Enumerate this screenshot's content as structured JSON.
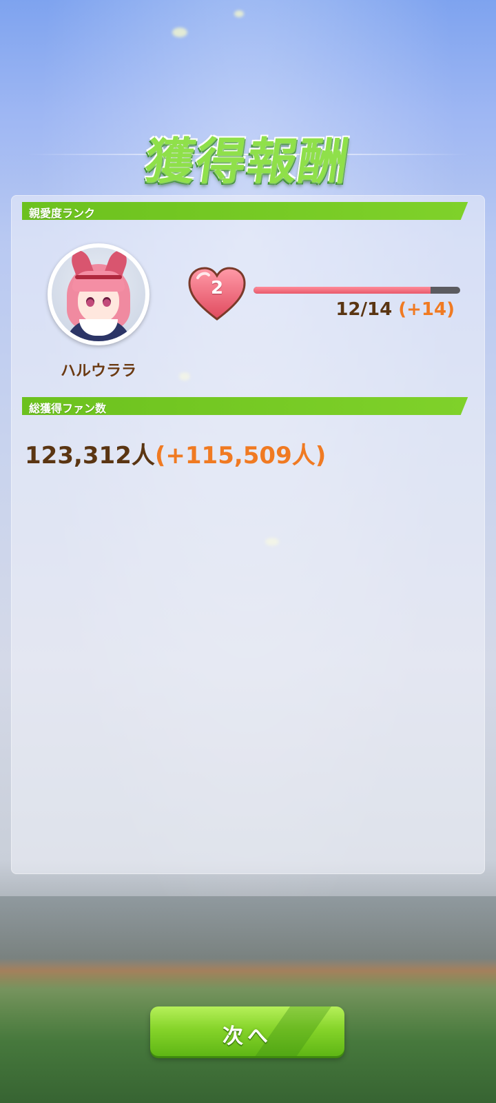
{
  "screen": {
    "title": "獲得報酬"
  },
  "affinity": {
    "section_label": "親愛度ランク",
    "character_name": "ハルウララ",
    "rank": "2",
    "progress_current": 12,
    "progress_max": 14,
    "progress_text": "12/14",
    "progress_gain": "(+14)"
  },
  "fans": {
    "section_label": "総獲得ファン数",
    "total": "123,312人",
    "gain": "(+115,509人)"
  },
  "next_button": {
    "label": "次へ"
  },
  "colors": {
    "accent_green": "#7fd12a",
    "text_brown": "#5a3512",
    "gain_orange": "#f07a22",
    "heart_red": "#e04a5e"
  },
  "icons": {
    "rank": "heart-icon"
  }
}
